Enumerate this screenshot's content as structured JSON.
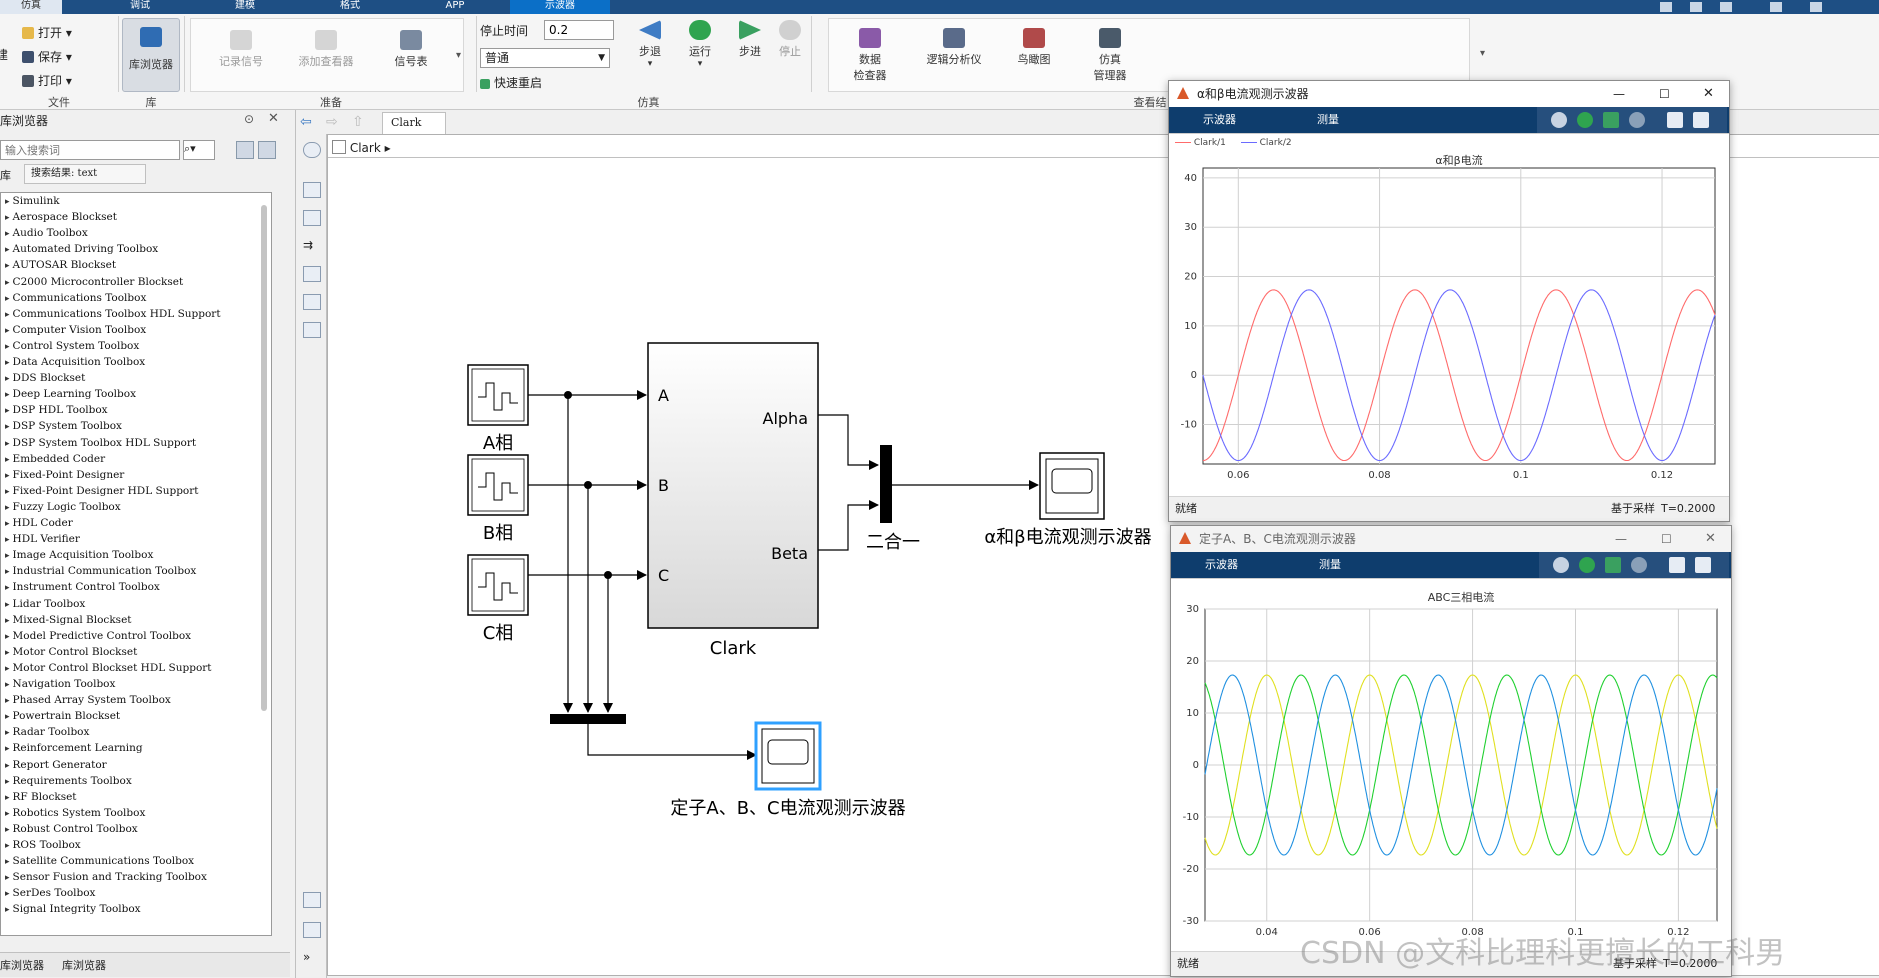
{
  "top_tabs": [
    "仿真",
    "调试",
    "建模",
    "格式",
    "APP",
    "示波器"
  ],
  "ribbon": {
    "file": {
      "open": "打开",
      "save": "保存",
      "print": "打印",
      "label": "文件",
      "new_partial": "建"
    },
    "library": {
      "browser": "库浏览器",
      "label": "库"
    },
    "prepare": {
      "log_signal": "记录信号",
      "add_viewer": "添加查看器",
      "signal_table": "信号表",
      "label": "准备"
    },
    "simulate": {
      "stop_time_label": "停止时间",
      "stop_time_value": "0.2",
      "mode": "普通",
      "fast_restart": "快速重启",
      "step_back": "步退",
      "run": "运行",
      "step_forward": "步进",
      "stop": "停止",
      "label": "仿真"
    },
    "review": {
      "data_inspector": "数据\n检查器",
      "logic_analyzer": "逻辑分析仪",
      "bird_eye": "鸟瞰图",
      "sim_manager": "仿真\n管理器",
      "label": "查看结"
    }
  },
  "library": {
    "title": "库浏览器",
    "search_placeholder": "输入搜索词",
    "tab_lib": "库",
    "tab_search": "搜索结果: text",
    "items": [
      "Simulink",
      "Aerospace Blockset",
      "Audio Toolbox",
      "Automated Driving Toolbox",
      "AUTOSAR Blockset",
      "C2000 Microcontroller Blockset",
      "Communications Toolbox",
      "Communications Toolbox HDL Support",
      "Computer Vision Toolbox",
      "Control System Toolbox",
      "Data Acquisition Toolbox",
      "DDS Blockset",
      "Deep Learning Toolbox",
      "DSP HDL Toolbox",
      "DSP System Toolbox",
      "DSP System Toolbox HDL Support",
      "Embedded Coder",
      "Fixed-Point Designer",
      "Fixed-Point Designer HDL Support",
      "Fuzzy Logic Toolbox",
      "HDL Coder",
      "HDL Verifier",
      "Image Acquisition Toolbox",
      "Industrial Communication Toolbox",
      "Instrument Control Toolbox",
      "Lidar Toolbox",
      "Mixed-Signal Blockset",
      "Model Predictive Control Toolbox",
      "Motor Control Blockset",
      "Motor Control Blockset HDL Support",
      "Navigation Toolbox",
      "Phased Array System Toolbox",
      "Powertrain Blockset",
      "Radar Toolbox",
      "Reinforcement Learning",
      "Report Generator",
      "Requirements Toolbox",
      "RF Blockset",
      "Robotics System Toolbox",
      "Robust Control Toolbox",
      "ROS Toolbox",
      "Satellite Communications Toolbox",
      "Sensor Fusion and Tracking Toolbox",
      "SerDes Toolbox",
      "Signal Integrity Toolbox"
    ],
    "bottom_tabs": [
      "库浏览器",
      "库浏览器"
    ]
  },
  "editor": {
    "tab": "Clark",
    "breadcrumb": "Clark"
  },
  "diagram": {
    "phase_a": "A相",
    "phase_b": "B相",
    "phase_c": "C相",
    "block_name": "Clark",
    "in_a": "A",
    "in_b": "B",
    "in_c": "C",
    "out_alpha": "Alpha",
    "out_beta": "Beta",
    "mux_label": "二合一",
    "scope1_label": "α和β电流观测示波器",
    "scope2_label": "定子A、B、C电流观测示波器"
  },
  "scope1": {
    "title": "α和β电流观测示波器",
    "tab1": "示波器",
    "tab2": "测量",
    "legend": [
      "Clark/1",
      "Clark/2"
    ],
    "status_left": "就绪",
    "status_mid": "基于采样",
    "status_right": "T=0.2000"
  },
  "scope2": {
    "title": "定子A、B、C电流观测示波器",
    "tab1": "示波器",
    "tab2": "测量",
    "status_left": "就绪",
    "status_mid": "基于采样",
    "status_right": "T=0.2000"
  },
  "watermark": "CSDN @文科比理科更擅长的工科男",
  "chart_data": [
    {
      "type": "line",
      "title": "α和β电流",
      "xlim": [
        0.055,
        0.1275
      ],
      "ylim": [
        -18,
        42
      ],
      "xticks": [
        0.06,
        0.08,
        0.1,
        0.12
      ],
      "yticks": [
        -10,
        0,
        10,
        20,
        30,
        40
      ],
      "grid": true,
      "series": [
        {
          "name": "Clark/1",
          "color": "#ff6b6b",
          "amplitude": 17.3,
          "frequency_hz": 50,
          "phase_deg": 0
        },
        {
          "name": "Clark/2",
          "color": "#6b6bff",
          "amplitude": 17.3,
          "frequency_hz": 50,
          "phase_deg": -90
        }
      ]
    },
    {
      "type": "line",
      "title": "ABC三相电流",
      "xlim": [
        0.028,
        0.1275
      ],
      "ylim": [
        -30,
        30
      ],
      "xticks": [
        0.04,
        0.06,
        0.08,
        0.1,
        0.12
      ],
      "yticks": [
        -30,
        -20,
        -10,
        0,
        10,
        20,
        30
      ],
      "grid": true,
      "series": [
        {
          "color": "#e0e020",
          "amplitude": 17.3,
          "frequency_hz": 50,
          "phase_deg": 90
        },
        {
          "color": "#20d030",
          "amplitude": 17.3,
          "frequency_hz": 50,
          "phase_deg": -30
        },
        {
          "color": "#2090e0",
          "amplitude": 17.3,
          "frequency_hz": 50,
          "phase_deg": 210
        }
      ]
    }
  ]
}
